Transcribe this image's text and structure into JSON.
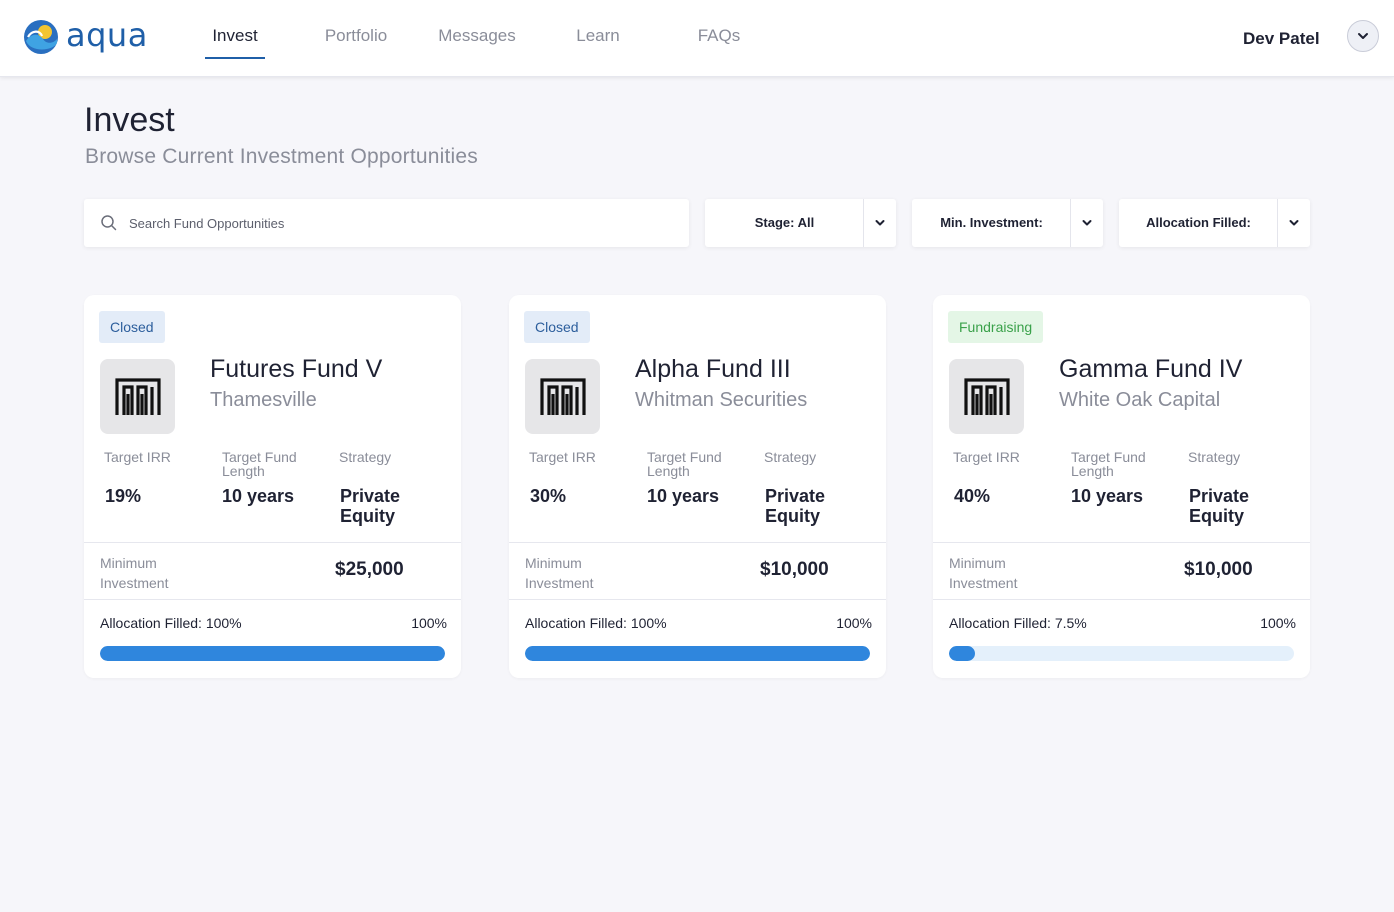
{
  "app": {
    "name": "aqua"
  },
  "nav": {
    "tabs": [
      {
        "label": "Invest",
        "active": true
      },
      {
        "label": "Portfolio",
        "active": false
      },
      {
        "label": "Messages",
        "active": false
      },
      {
        "label": "Learn",
        "active": false
      },
      {
        "label": "FAQs",
        "active": false
      }
    ],
    "user": {
      "name": "Dev Patel",
      "menu_icon": "chevron-down-icon"
    }
  },
  "page": {
    "title": "Invest",
    "subtitle": "Browse Current Investment Opportunities"
  },
  "filters": {
    "search": {
      "placeholder": "Search Fund Opportunities",
      "value": "",
      "icon": "search-icon"
    },
    "stage": {
      "label": "Stage: All"
    },
    "min_investment": {
      "label": "Min. Investment:"
    },
    "allocation_filled": {
      "label": "Allocation Filled:"
    }
  },
  "labels": {
    "target_irr": "Target IRR",
    "target_fund_length": "Target Fund Length",
    "strategy": "Strategy",
    "minimum_investment": "Minimum Investment",
    "allocation_prefix": "Allocation Filled: "
  },
  "colors": {
    "brand": "#1f5fa8",
    "progress": "#2f86dd",
    "closed_badge_bg": "#e3ecf8",
    "fundraising_badge_bg": "#e4f6e6",
    "fundraising_badge_text": "#3aa14a"
  },
  "funds": [
    {
      "status": "Closed",
      "name": "Futures Fund V",
      "firm": "Thamesville",
      "target_irr": "19%",
      "target_fund_length": "10 years",
      "strategy": "Private Equity",
      "minimum_investment": "$25,000",
      "allocation_filled_text": "100%",
      "allocation_max": "100%",
      "allocation_filled_fraction": 1.0
    },
    {
      "status": "Closed",
      "name": "Alpha Fund III",
      "firm": "Whitman Securities",
      "target_irr": "30%",
      "target_fund_length": "10 years",
      "strategy": "Private Equity",
      "minimum_investment": "$10,000",
      "allocation_filled_text": "100%",
      "allocation_max": "100%",
      "allocation_filled_fraction": 1.0
    },
    {
      "status": "Fundraising",
      "name": "Gamma Fund IV",
      "firm": "White Oak Capital",
      "target_irr": "40%",
      "target_fund_length": "10 years",
      "strategy": "Private Equity",
      "minimum_investment": "$10,000",
      "allocation_filled_text": "7.5%",
      "allocation_max": "100%",
      "allocation_filled_fraction": 0.075
    }
  ]
}
